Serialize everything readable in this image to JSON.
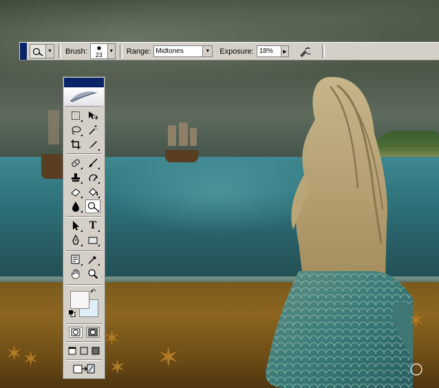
{
  "options_bar": {
    "tool_preset_icon": "dodge-tool-icon",
    "brush_label": "Brush:",
    "brush_size": "23",
    "range_label": "Range:",
    "range_value": "Midtones",
    "exposure_label": "Exposure:",
    "exposure_value": "18%",
    "airbrush_icon": "airbrush-icon"
  },
  "toolbox": {
    "tools": [
      {
        "name": "marquee-tool-icon"
      },
      {
        "name": "move-tool-icon"
      },
      {
        "name": "lasso-tool-icon"
      },
      {
        "name": "magic-wand-tool-icon"
      },
      {
        "name": "crop-tool-icon"
      },
      {
        "name": "slice-tool-icon"
      },
      {
        "name": "healing-brush-tool-icon"
      },
      {
        "name": "brush-tool-icon"
      },
      {
        "name": "clone-stamp-tool-icon"
      },
      {
        "name": "history-brush-tool-icon"
      },
      {
        "name": "eraser-tool-icon"
      },
      {
        "name": "paint-bucket-tool-icon"
      },
      {
        "name": "blur-tool-icon"
      },
      {
        "name": "dodge-tool-icon"
      },
      {
        "name": "path-selection-tool-icon"
      },
      {
        "name": "type-tool-icon"
      },
      {
        "name": "pen-tool-icon"
      },
      {
        "name": "rectangle-tool-icon"
      },
      {
        "name": "notes-tool-icon"
      },
      {
        "name": "eyedropper-tool-icon"
      },
      {
        "name": "hand-tool-icon"
      },
      {
        "name": "zoom-tool-icon"
      }
    ],
    "type_tool_glyph": "T",
    "foreground_color": "#f7f6f4",
    "background_color": "#dff0fa",
    "active_tool": "dodge-tool-icon"
  },
  "colors": {
    "title_bar": "#0a246a",
    "panel_bg": "#d4d0c8"
  }
}
